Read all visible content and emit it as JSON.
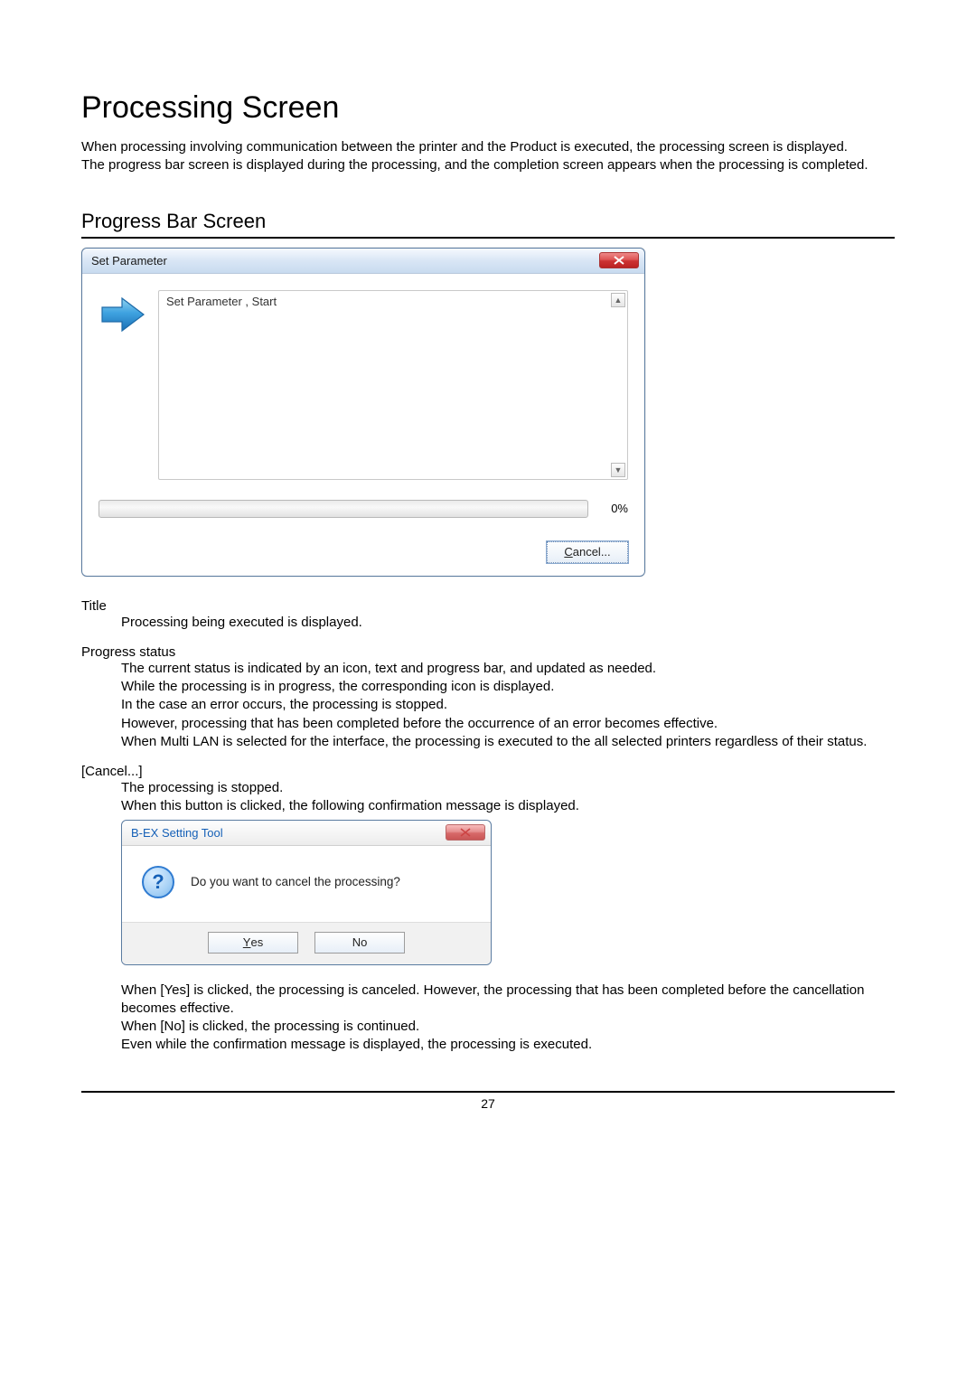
{
  "heading": "Processing Screen",
  "intro": [
    "When processing involving communication between the printer and the Product is executed, the processing screen is displayed.",
    "The progress bar screen is displayed during the processing, and the completion screen appears when the processing is completed."
  ],
  "section_heading": "Progress Bar Screen",
  "progress_dialog": {
    "title": "Set Parameter",
    "log_line": "Set Parameter , Start",
    "percent": "0%",
    "cancel_label": "Cancel..."
  },
  "terms": {
    "title": {
      "label": "Title",
      "lines": [
        "Processing being executed is displayed."
      ]
    },
    "status": {
      "label": "Progress status",
      "lines": [
        "The current status is indicated by an icon, text and progress bar, and updated as needed.",
        "While the processing is in progress, the corresponding icon is displayed.",
        "In the case an error occurs, the processing is stopped.",
        "However, processing that has been completed before the occurrence of an error becomes effective.",
        "When Multi LAN is selected for the interface, the processing is executed to the all selected printers regardless of their status."
      ]
    },
    "cancel": {
      "label": "[Cancel...]",
      "lines": [
        "The processing is stopped.",
        "When this button is clicked, the following confirmation message is displayed."
      ]
    }
  },
  "confirm_dialog": {
    "title": "B-EX Setting Tool",
    "message": "Do you want to cancel the processing?",
    "yes_label": "Yes",
    "no_label": "No"
  },
  "after_confirm": [
    "When [Yes] is clicked, the processing is canceled.    However, the processing that has been completed before the cancellation becomes effective.",
    "When [No] is clicked, the processing is continued.",
    "Even while the confirmation message is displayed, the processing is executed."
  ],
  "page_number": "27"
}
